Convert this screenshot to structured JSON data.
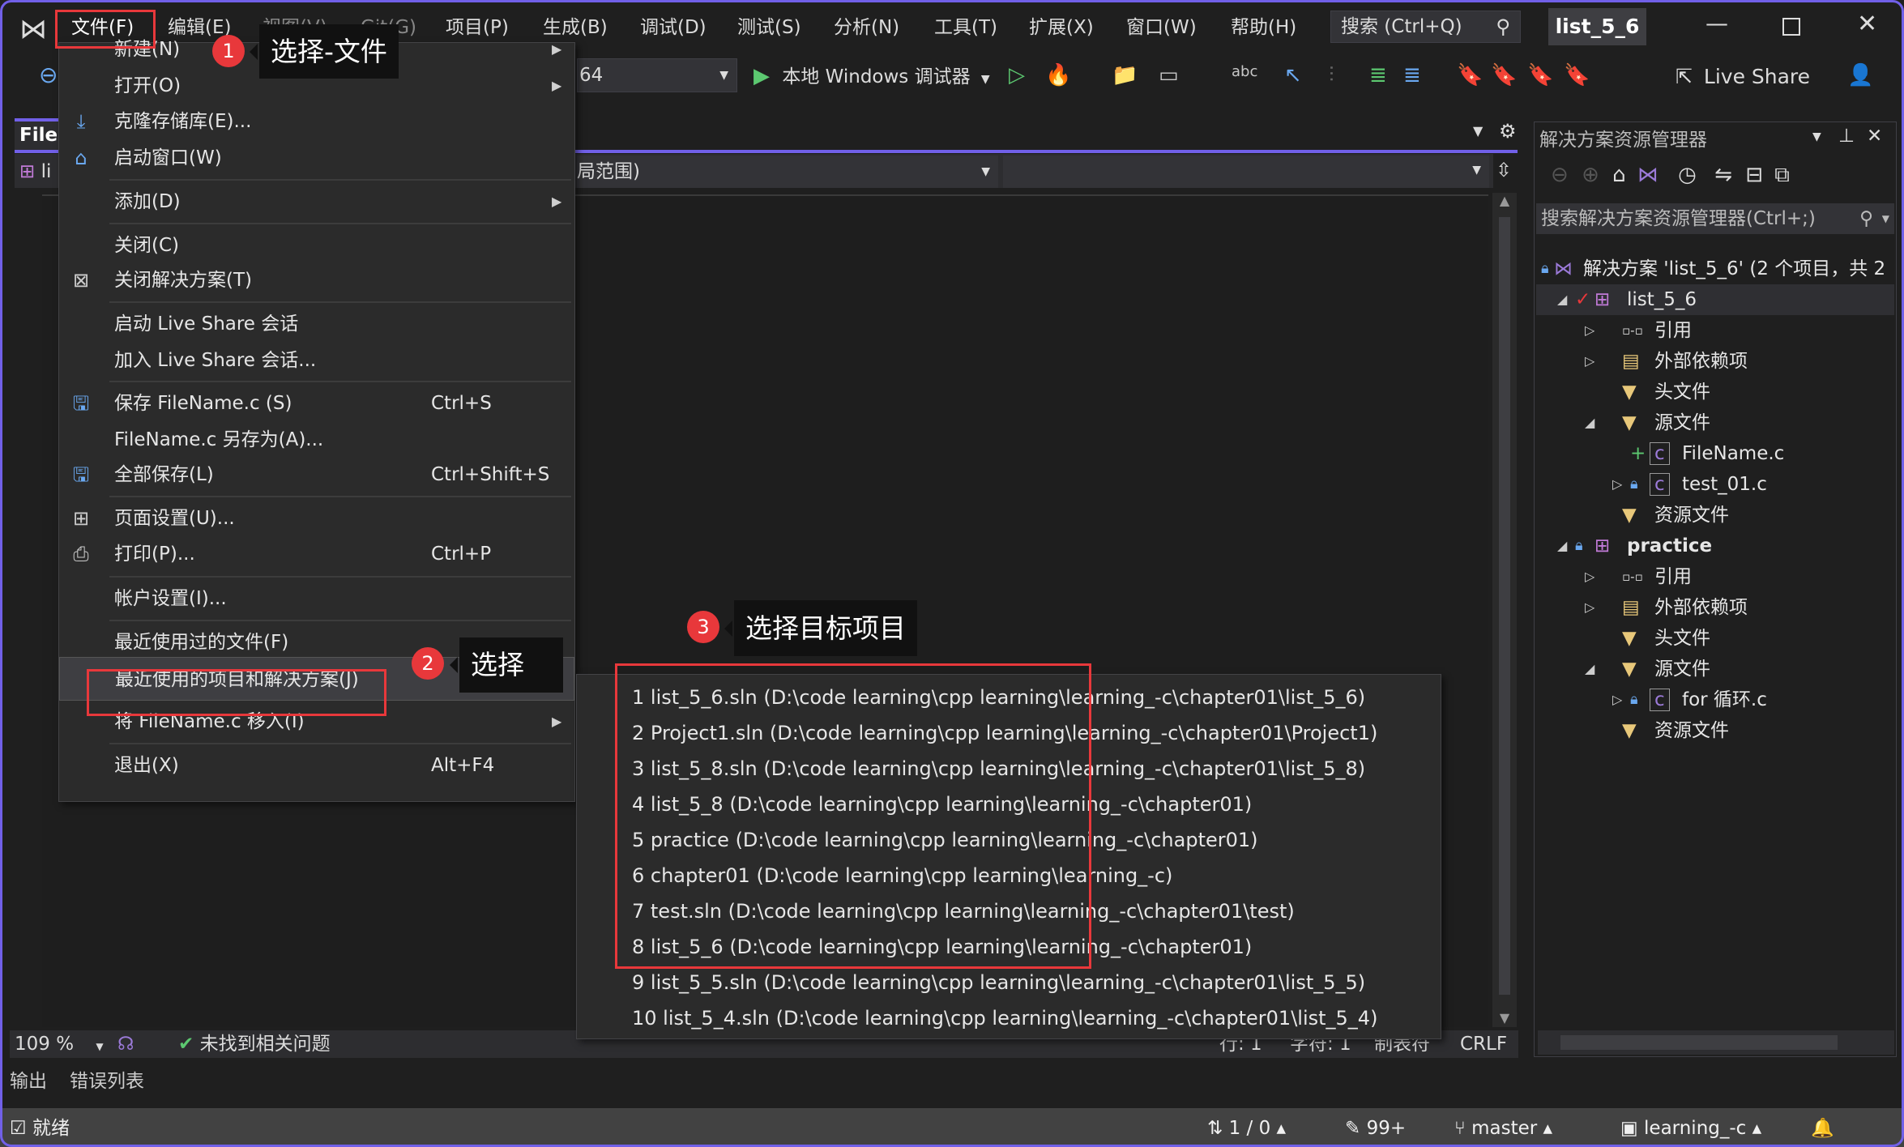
{
  "menubar": {
    "items": [
      "文件(F)",
      "编辑(E)",
      "视图(V)",
      "Git(G)",
      "项目(P)",
      "生成(B)",
      "调试(D)",
      "测试(S)",
      "分析(N)",
      "工具(T)",
      "扩展(X)",
      "窗口(W)",
      "帮助(H)"
    ],
    "search_placeholder": "搜索 (Ctrl+Q)",
    "window_title": "list_5_6"
  },
  "toolbar": {
    "platform_value": "64",
    "debugger_label": "本地 Windows 调试器",
    "live_share_label": "Live Share"
  },
  "editor": {
    "tab_label": "FileN",
    "nav_scope_label": "局范围)",
    "nav_project_label": "li",
    "zoom": "109 %",
    "issues": "未找到相关问题",
    "line": "行: 1",
    "char": "字符: 1",
    "tabs_mode": "制表符",
    "line_ending": "CRLF"
  },
  "file_menu": {
    "items": [
      {
        "label": "新建(N)",
        "submenu": true
      },
      {
        "label": "打开(O)",
        "submenu": true
      },
      {
        "label": "克隆存储库(E)...",
        "icon": "clone-repo-icon"
      },
      {
        "label": "启动窗口(W)",
        "icon": "start-window-icon"
      },
      {
        "label": "添加(D)",
        "submenu": true
      },
      {
        "label": "关闭(C)"
      },
      {
        "label": "关闭解决方案(T)",
        "icon": "close-solution-icon"
      },
      {
        "label": "启动 Live Share 会话"
      },
      {
        "label": "加入 Live Share 会话..."
      },
      {
        "label": "保存 FileName.c (S)",
        "shortcut": "Ctrl+S",
        "icon": "save-icon"
      },
      {
        "label": "FileName.c 另存为(A)..."
      },
      {
        "label": "全部保存(L)",
        "shortcut": "Ctrl+Shift+S",
        "icon": "save-all-icon"
      },
      {
        "label": "页面设置(U)...",
        "icon": "page-setup-icon"
      },
      {
        "label": "打印(P)...",
        "shortcut": "Ctrl+P",
        "icon": "print-icon"
      },
      {
        "label": "帐户设置(I)..."
      },
      {
        "label": "最近使用过的文件(F)",
        "submenu": true
      },
      {
        "label": "最近使用的项目和解决方案(J)",
        "submenu": true,
        "highlighted": true
      },
      {
        "label": "将 FileName.c 移入(I)",
        "submenu": true
      },
      {
        "label": "退出(X)",
        "shortcut": "Alt+F4"
      }
    ]
  },
  "recent_projects": [
    "1 list_5_6.sln (D:\\code learning\\cpp learning\\learning_-c\\chapter01\\list_5_6)",
    "2 Project1.sln (D:\\code learning\\cpp learning\\learning_-c\\chapter01\\Project1)",
    "3 list_5_8.sln (D:\\code learning\\cpp learning\\learning_-c\\chapter01\\list_5_8)",
    "4 list_5_8 (D:\\code learning\\cpp learning\\learning_-c\\chapter01)",
    "5 practice (D:\\code learning\\cpp learning\\learning_-c\\chapter01)",
    "6 chapter01 (D:\\code learning\\cpp learning\\learning_-c)",
    "7 test.sln (D:\\code learning\\cpp learning\\learning_-c\\chapter01\\test)",
    "8 list_5_6 (D:\\code learning\\cpp learning\\learning_-c\\chapter01)",
    "9 list_5_5.sln (D:\\code learning\\cpp learning\\learning_-c\\chapter01\\list_5_5)",
    "10 list_5_4.sln (D:\\code learning\\cpp learning\\learning_-c\\chapter01\\list_5_4)"
  ],
  "annotations": [
    {
      "number": "1",
      "text": "选择-文件"
    },
    {
      "number": "2",
      "text": "选择"
    },
    {
      "number": "3",
      "text": "选择目标项目"
    }
  ],
  "solution_explorer": {
    "title": "解决方案资源管理器",
    "search_placeholder": "搜索解决方案资源管理器(Ctrl+;)",
    "tree": [
      {
        "label": "解决方案 'list_5_6' (2 个项目，共 2",
        "level": 0,
        "icon": "solution-icon",
        "lock": true
      },
      {
        "label": "list_5_6",
        "level": 1,
        "icon": "project-icon",
        "expander": "open",
        "check": true,
        "selected": true
      },
      {
        "label": "引用",
        "level": 2,
        "icon": "references-icon",
        "expander": "closed"
      },
      {
        "label": "外部依赖项",
        "level": 2,
        "icon": "folder-icon",
        "expander": "closed"
      },
      {
        "label": "头文件",
        "level": 2,
        "icon": "filter-folder-icon"
      },
      {
        "label": "源文件",
        "level": 2,
        "icon": "filter-folder-icon",
        "expander": "open"
      },
      {
        "label": "FileName.c",
        "level": 3,
        "icon": "c-file-icon",
        "added": true
      },
      {
        "label": "test_01.c",
        "level": 3,
        "icon": "c-file-icon",
        "expander": "closed",
        "lock": true
      },
      {
        "label": "资源文件",
        "level": 2,
        "icon": "filter-folder-icon"
      },
      {
        "label": "practice",
        "level": 1,
        "icon": "project-icon",
        "expander": "open",
        "lock": true,
        "bold": true
      },
      {
        "label": "引用",
        "level": 2,
        "icon": "references-icon",
        "expander": "closed"
      },
      {
        "label": "外部依赖项",
        "level": 2,
        "icon": "folder-icon",
        "expander": "closed"
      },
      {
        "label": "头文件",
        "level": 2,
        "icon": "filter-folder-icon"
      },
      {
        "label": "源文件",
        "level": 2,
        "icon": "filter-folder-icon",
        "expander": "open"
      },
      {
        "label": "for 循环.c",
        "level": 3,
        "icon": "c-file-icon",
        "expander": "closed",
        "lock": true
      },
      {
        "label": "资源文件",
        "level": 2,
        "icon": "filter-folder-icon"
      }
    ]
  },
  "bottom_tabs": [
    "输出",
    "错误列表"
  ],
  "statusbar": {
    "ready": "就绪",
    "sync": "1 / 0",
    "changes": "99+",
    "branch": "master",
    "repo": "learning_-c"
  },
  "colors": {
    "accent": "#7160e8",
    "annotation_red": "#e8383b",
    "menu_bg": "#2b2b2b"
  }
}
